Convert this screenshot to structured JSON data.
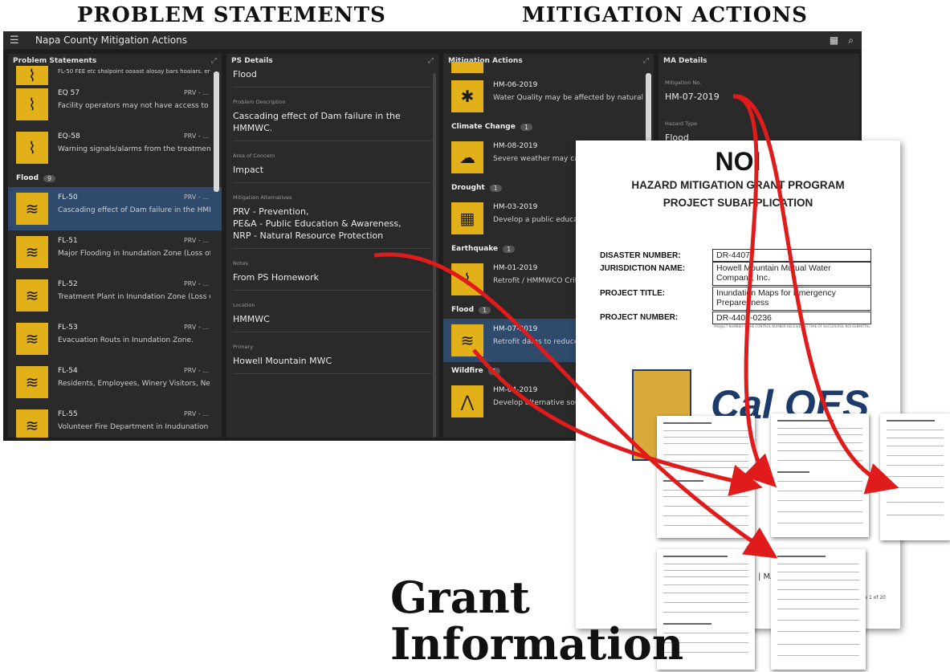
{
  "headings": {
    "problem": "PROBLEM STATEMENTS",
    "mitigation": "MITIGATION ACTIONS",
    "grant_line1": "Grant",
    "grant_line2": "Information"
  },
  "app": {
    "title": "Napa County Mitigation Actions",
    "menu_icon": "menu-icon",
    "layout_icon": "layout-icon",
    "search_icon": "search-icon"
  },
  "problem_statements": {
    "header": "Problem Statements",
    "top_partial": "FL-50 FEE etc shalpoint ooaast alosay bars hoaiars. erinae",
    "items_top": [
      {
        "id": "EQ 57",
        "prv": "PRV - ...",
        "desc": "Facility operators may not have access to operate"
      },
      {
        "id": "EQ-58",
        "prv": "PRV - ...",
        "desc": "Warning signals/alarms from the treatment plant w"
      }
    ],
    "group": {
      "label": "Flood",
      "count": "9"
    },
    "items": [
      {
        "id": "FL-50",
        "prv": "PRV - ...",
        "desc": "Cascading effect of Dam failure in the HMMWC"
      },
      {
        "id": "FL-51",
        "prv": "PRV - ...",
        "desc": "Major Flooding in Inundation Zone (Loss of Life an"
      },
      {
        "id": "FL-52",
        "prv": "PRV - ...",
        "desc": "Treatment Plant in Inundation Zone (Loss of ability"
      },
      {
        "id": "FL-53",
        "prv": "PRV - ...",
        "desc": "Evacuation Routs in Inundation Zone."
      },
      {
        "id": "FL-54",
        "prv": "PRV - ...",
        "desc": "Residents, Employees, Winery Visitors, Neighbors i"
      },
      {
        "id": "FL-55",
        "prv": "PRV - ...",
        "desc": "Volunteer Fire Department in Inudunation Zone, M"
      }
    ]
  },
  "ps_details": {
    "header": "PS Details",
    "hazard": "Flood",
    "description_label": "Problem Description",
    "description": "Cascading effect of Dam failure in the HMMWC.",
    "area_label": "Area of Concern",
    "area": "Impact",
    "alternatives_label": "Mitigation Alternatives",
    "alternatives": [
      "PRV - Prevention,",
      "PE&A - Public Education & Awareness,",
      "NRP - Natural Resource Protection"
    ],
    "notes_label": "Notes",
    "notes": "From PS Homework",
    "location_label": "Location",
    "location": "HMMWC",
    "primary_label": "Primary",
    "primary": "Howell Mountain MWC"
  },
  "mitigation_actions": {
    "header": "Mitigation Actions",
    "first": {
      "id": "HM-06-2019",
      "desc": "Water Quality may be affected by natural hazard ev"
    },
    "groups": [
      {
        "label": "Climate Change",
        "count": "1",
        "item": {
          "id": "HM-08-2019",
          "desc": "Severe weather may cause in"
        }
      },
      {
        "label": "Drought",
        "count": "1",
        "item": {
          "id": "HM-03-2019",
          "desc": "Develop a public education c"
        }
      },
      {
        "label": "Earthquake",
        "count": "1",
        "item": {
          "id": "HM-01-2019",
          "desc": "Retrofit / HMMWCO Critical"
        }
      },
      {
        "label": "Flood",
        "count": "1",
        "item": {
          "id": "HM-07-2019",
          "desc": "Retrofit dams to reduce the"
        }
      },
      {
        "label": "Wildfire",
        "count": "1",
        "item": {
          "id": "HM-04-2019",
          "desc": "Develop alternative sources"
        }
      }
    ]
  },
  "ma_details": {
    "header": "MA Details",
    "number_label": "Mitigation No.",
    "number": "HM-07-2019",
    "hazard_label": "Hazard Type",
    "hazard": "Flood"
  },
  "noi": {
    "title": "NOI",
    "subtitle1": "HAZARD MITIGATION GRANT PROGRAM",
    "subtitle2": "PROJECT SUBAPPLICATION",
    "disaster_label": "DISASTER NUMBER:",
    "disaster": "DR-4407",
    "jurisdiction_label": "JURISDICTION NAME:",
    "jurisdiction": "Howell Mountain Mutual Water Company, Inc.",
    "title_label": "PROJECT TITLE:",
    "project_title": "Inundation Maps for Emergency Preparedness",
    "number_label": "PROJECT NUMBER:",
    "project_number": "DR-4407-0236",
    "note": "PROJECT NUMBER IS THE CONTROL NUMBER RECEIVED AT TIME OF SUCCESSFUL NOI SUBMITTAL",
    "logo": "Cal OES",
    "footer_left": "| MA",
    "page": "Page 1 of 20"
  },
  "colors": {
    "accent": "#e2b019",
    "arrow": "#e01b1b",
    "selected": "#2f4a6a"
  }
}
